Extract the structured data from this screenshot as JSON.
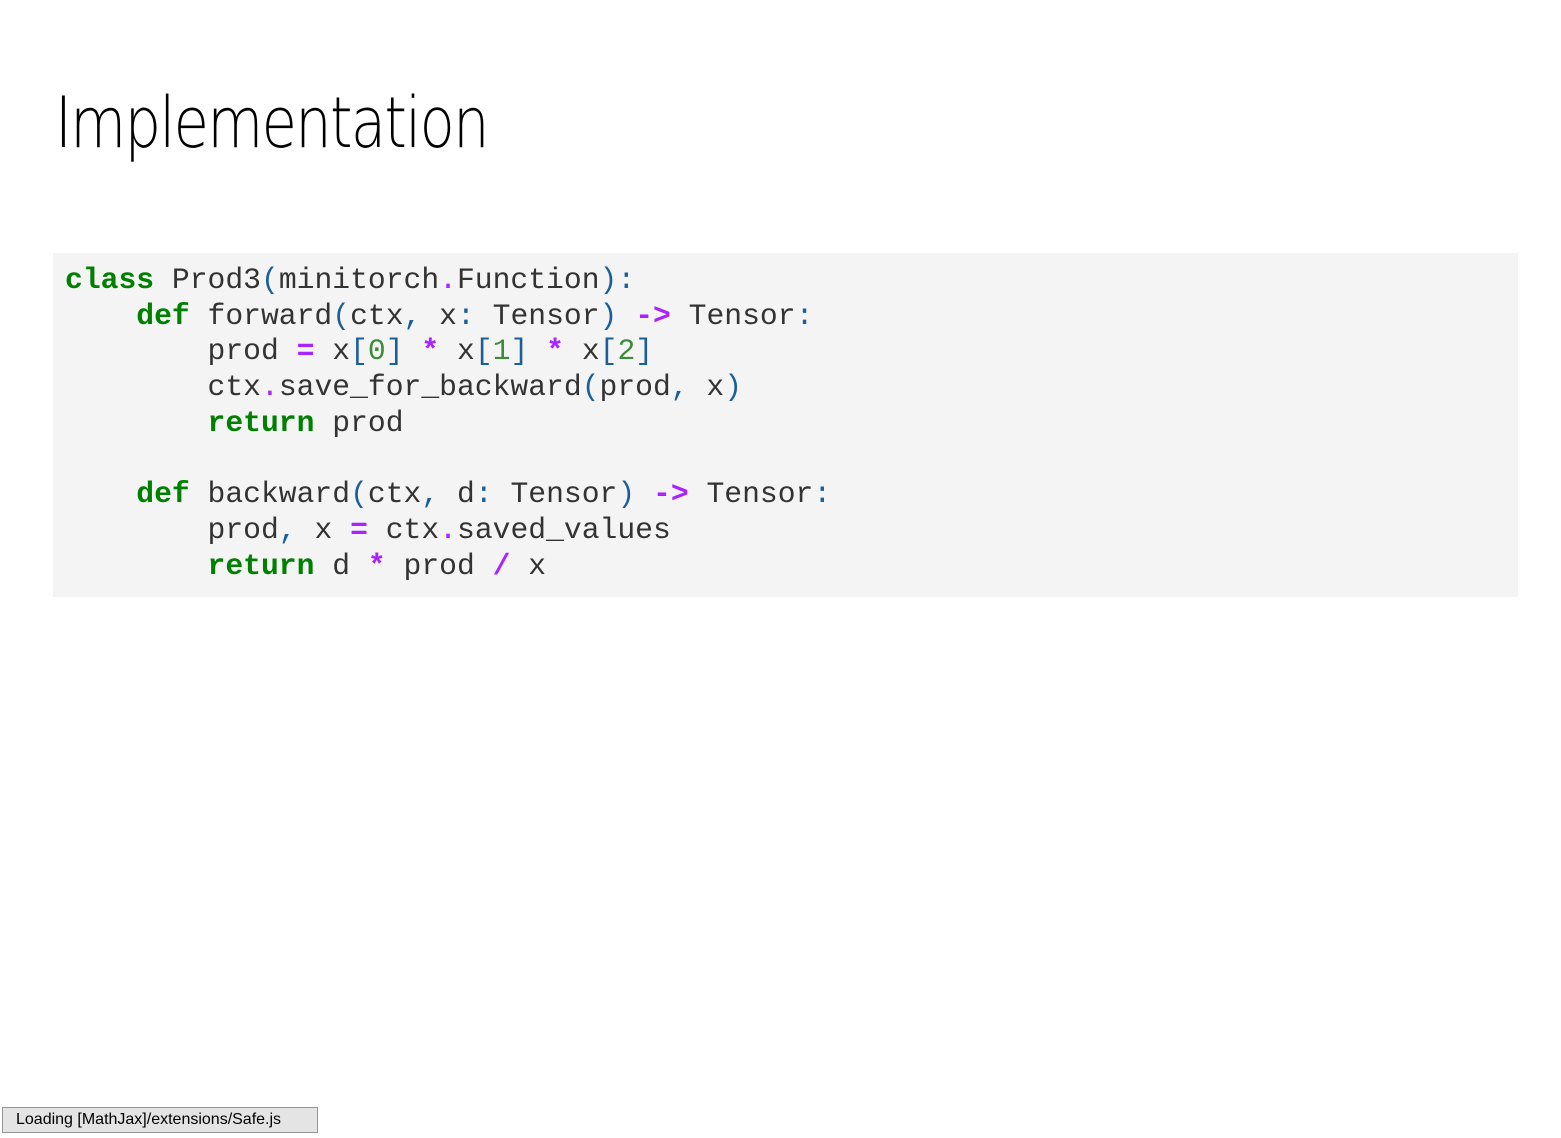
{
  "slide": {
    "title": "Implementation"
  },
  "code": {
    "language": "python",
    "lines": [
      [
        {
          "t": "kw",
          "v": "class"
        },
        {
          "t": "name",
          "v": " Prod3"
        },
        {
          "t": "punct",
          "v": "("
        },
        {
          "t": "name",
          "v": "minitorch"
        },
        {
          "t": "dot",
          "v": "."
        },
        {
          "t": "name",
          "v": "Function"
        },
        {
          "t": "punct",
          "v": "):"
        }
      ],
      [
        {
          "t": "name",
          "v": "    "
        },
        {
          "t": "kw",
          "v": "def"
        },
        {
          "t": "name",
          "v": " forward"
        },
        {
          "t": "punct",
          "v": "("
        },
        {
          "t": "name",
          "v": "ctx"
        },
        {
          "t": "punct",
          "v": ","
        },
        {
          "t": "name",
          "v": " x"
        },
        {
          "t": "punct",
          "v": ":"
        },
        {
          "t": "name",
          "v": " Tensor"
        },
        {
          "t": "punct",
          "v": ")"
        },
        {
          "t": "name",
          "v": " "
        },
        {
          "t": "op",
          "v": "->"
        },
        {
          "t": "name",
          "v": " Tensor"
        },
        {
          "t": "punct",
          "v": ":"
        }
      ],
      [
        {
          "t": "name",
          "v": "        prod "
        },
        {
          "t": "op",
          "v": "="
        },
        {
          "t": "name",
          "v": " x"
        },
        {
          "t": "punct",
          "v": "["
        },
        {
          "t": "num",
          "v": "0"
        },
        {
          "t": "punct",
          "v": "]"
        },
        {
          "t": "name",
          "v": " "
        },
        {
          "t": "op",
          "v": "*"
        },
        {
          "t": "name",
          "v": " x"
        },
        {
          "t": "punct",
          "v": "["
        },
        {
          "t": "num",
          "v": "1"
        },
        {
          "t": "punct",
          "v": "]"
        },
        {
          "t": "name",
          "v": " "
        },
        {
          "t": "op",
          "v": "*"
        },
        {
          "t": "name",
          "v": " x"
        },
        {
          "t": "punct",
          "v": "["
        },
        {
          "t": "num",
          "v": "2"
        },
        {
          "t": "punct",
          "v": "]"
        }
      ],
      [
        {
          "t": "name",
          "v": "        ctx"
        },
        {
          "t": "dot",
          "v": "."
        },
        {
          "t": "name",
          "v": "save_for_backward"
        },
        {
          "t": "punct",
          "v": "("
        },
        {
          "t": "name",
          "v": "prod"
        },
        {
          "t": "punct",
          "v": ","
        },
        {
          "t": "name",
          "v": " x"
        },
        {
          "t": "punct",
          "v": ")"
        }
      ],
      [
        {
          "t": "name",
          "v": "        "
        },
        {
          "t": "kw",
          "v": "return"
        },
        {
          "t": "name",
          "v": " prod"
        }
      ],
      [],
      [
        {
          "t": "name",
          "v": "    "
        },
        {
          "t": "kw",
          "v": "def"
        },
        {
          "t": "name",
          "v": " backward"
        },
        {
          "t": "punct",
          "v": "("
        },
        {
          "t": "name",
          "v": "ctx"
        },
        {
          "t": "punct",
          "v": ","
        },
        {
          "t": "name",
          "v": " d"
        },
        {
          "t": "punct",
          "v": ":"
        },
        {
          "t": "name",
          "v": " Tensor"
        },
        {
          "t": "punct",
          "v": ")"
        },
        {
          "t": "name",
          "v": " "
        },
        {
          "t": "op",
          "v": "->"
        },
        {
          "t": "name",
          "v": " Tensor"
        },
        {
          "t": "punct",
          "v": ":"
        }
      ],
      [
        {
          "t": "name",
          "v": "        prod"
        },
        {
          "t": "punct",
          "v": ","
        },
        {
          "t": "name",
          "v": " x "
        },
        {
          "t": "op",
          "v": "="
        },
        {
          "t": "name",
          "v": " ctx"
        },
        {
          "t": "dot",
          "v": "."
        },
        {
          "t": "name",
          "v": "saved_values"
        }
      ],
      [
        {
          "t": "name",
          "v": "        "
        },
        {
          "t": "kw",
          "v": "return"
        },
        {
          "t": "name",
          "v": " d "
        },
        {
          "t": "op",
          "v": "*"
        },
        {
          "t": "name",
          "v": " prod "
        },
        {
          "t": "op",
          "v": "/"
        },
        {
          "t": "name",
          "v": " x"
        }
      ]
    ]
  },
  "status": {
    "message": "Loading [MathJax]/extensions/Safe.js"
  },
  "colors": {
    "background": "#ffffff",
    "code_background": "#f4f4f4",
    "keyword": "#008000",
    "operator": "#aa22ff",
    "punctuation": "#1a5e9a",
    "number": "#3a8c3a",
    "text": "#333333"
  }
}
